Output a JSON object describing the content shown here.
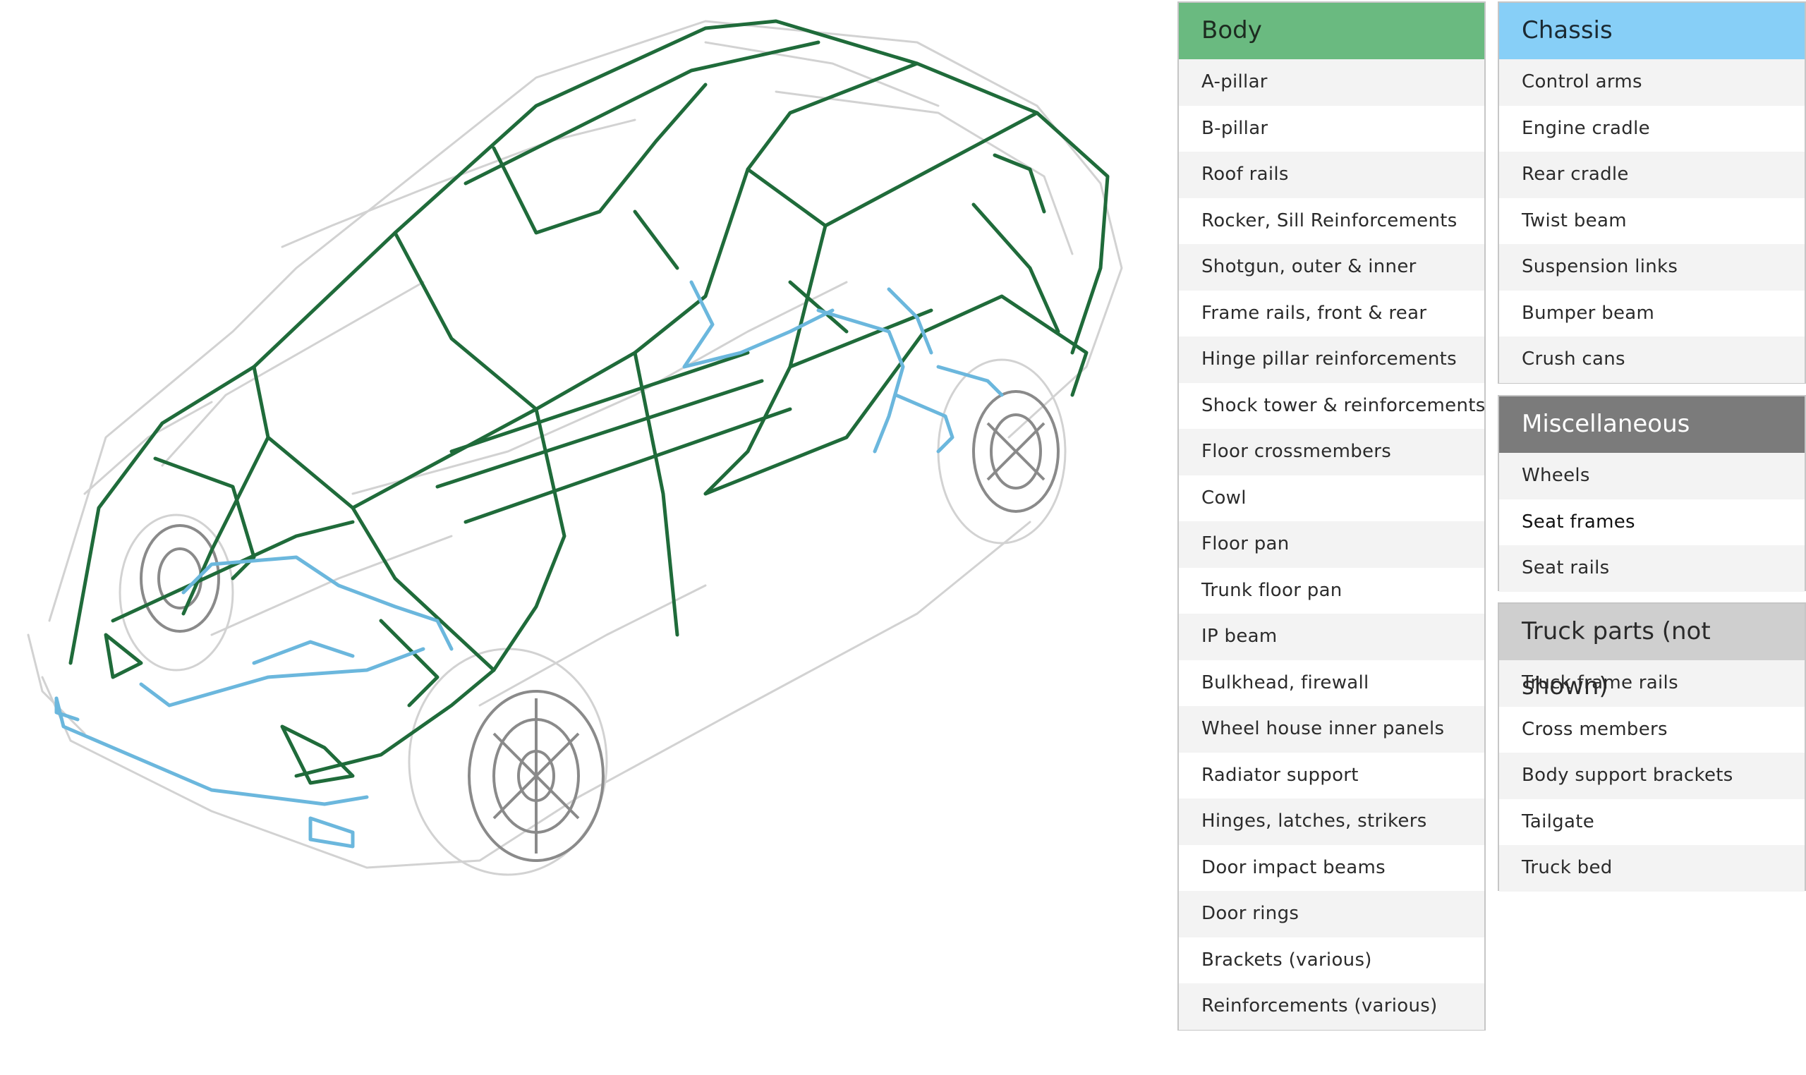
{
  "colors": {
    "body_green": "#6aba80",
    "chassis_blue": "#87cff7",
    "misc_gray": "#7b7b7b",
    "truck_light_gray": "#cfcfcf",
    "drawing_green": "#1f6b3a",
    "drawing_blue": "#6bb7dd",
    "drawing_gray": "#c8c8c8"
  },
  "body": {
    "title": "Body",
    "items": [
      "A-pillar",
      "B-pillar",
      "Roof rails",
      "Rocker, Sill Reinforcements",
      "Shotgun, outer & inner",
      "Frame rails, front & rear",
      "Hinge pillar reinforcements",
      "Shock tower & reinforcements",
      "Floor crossmembers",
      "Cowl",
      "Floor pan",
      "Trunk floor pan",
      "IP beam",
      "Bulkhead, firewall",
      "Wheel house inner panels",
      "Radiator support",
      "Hinges, latches, strikers",
      "Door impact beams",
      "Door rings",
      "Brackets (various)",
      "Reinforcements (various)"
    ]
  },
  "chassis": {
    "title": "Chassis",
    "items": [
      "Control arms",
      "Engine cradle",
      "Rear cradle",
      "Twist beam",
      "Suspension links",
      "Bumper beam",
      "Crush cans"
    ]
  },
  "misc": {
    "title": "Miscellaneous",
    "items": [
      "Wheels",
      "Seat frames",
      "Seat rails"
    ]
  },
  "truck": {
    "title": "Truck parts (not shown)",
    "items": [
      "Truck frame rails",
      "Cross members",
      "Body support brackets",
      "Tailgate",
      "Truck bed"
    ]
  }
}
